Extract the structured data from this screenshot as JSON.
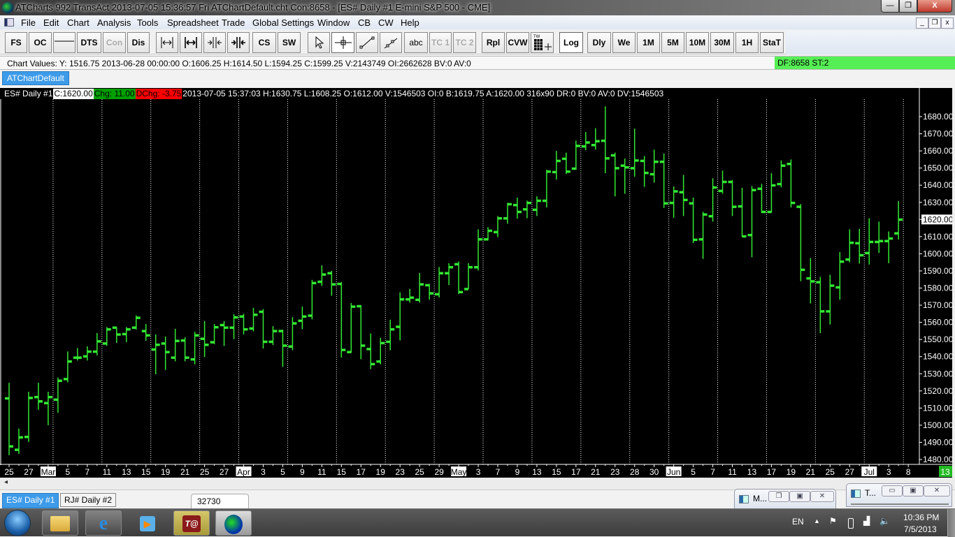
{
  "window": {
    "title": "ATCharts 992 TransAct 2013-07-05  15:36:57 Fri  ATChartDefault.cht Con:8658 - [ES#  Daily  #1  E-mini S&P 500 - CME]",
    "minimize": "—",
    "restore": "❐",
    "close": "X"
  },
  "menu": [
    "File",
    "Edit",
    "Chart",
    "Analysis",
    "Tools",
    "Spreadsheet",
    "Trade",
    "Global Settings",
    "Window",
    "CB",
    "CW",
    "Help"
  ],
  "mdi_controls": {
    "minimize": "_",
    "restore": "❐",
    "close": "x"
  },
  "toolbar": {
    "fs": "FS",
    "oc": "OC",
    "dts": "DTS",
    "con": "Con",
    "dis": "Dis",
    "cs": "CS",
    "sw": "SW",
    "abc": "abc",
    "tc1": "TC 1",
    "tc2": "TC 2",
    "rpl": "Rpl",
    "cvw": "CVW",
    "tw": "TW",
    "log": "Log",
    "dly": "Dly",
    "we": "We",
    "m1": "1M",
    "m5": "5M",
    "m10": "10M",
    "m30": "30M",
    "h1": "1H",
    "stat": "StaT"
  },
  "chart_values": {
    "text": "Chart Values: Y: 1516.75  2013-06-28  00:00:00  O:1606.25  H:1614.50  L:1594.25  C:1599.25  V:2143749  OI:2662628  BV:0  AV:0",
    "status": "DF:8658  ST:2"
  },
  "tabs": {
    "top": "ATChartDefault",
    "bottom": [
      "ES#  Daily  #1",
      "RJ#  Daily  #2"
    ]
  },
  "chart_header": {
    "symbol": "ES#  Daily  #1",
    "close": "C:1620.00",
    "chg": "Chg: 11.00",
    "dchg": "DChg: -3.75",
    "rest": "2013-07-05 15:37:03 H:1630.75 L:1608.25 O:1612.00 V:1546503 OI:0 B:1619.75 A:1620.00 316x90 DR:0 BV:0 AV:0 DV:1546503"
  },
  "colors": {
    "bar": "#33e833",
    "up_box": "#00a000",
    "down_box": "#ff0000",
    "status_green": "#55ee55",
    "tab_blue": "#3d9be9"
  },
  "chart_data": {
    "type": "ohlc",
    "symbol": "ES#",
    "ylim": [
      1480,
      1680
    ],
    "y_ticks": [
      "1680.00",
      "1670.00",
      "1660.00",
      "1650.00",
      "1640.00",
      "1630.00",
      "1620.00",
      "1610.00",
      "1600.00",
      "1590.00",
      "1580.00",
      "1570.00",
      "1560.00",
      "1550.00",
      "1540.00",
      "1530.00",
      "1520.00",
      "1510.00",
      "1500.00",
      "1490.00",
      "1480.00"
    ],
    "last_price_label": "1620.00",
    "last_price": 1620,
    "corner_label": "13",
    "week_start_bars": [
      5,
      10,
      15,
      20,
      24,
      29,
      34,
      39,
      44,
      49,
      54,
      59,
      64,
      68,
      73,
      78,
      83,
      88,
      92
    ],
    "x_labels": [
      {
        "bar": 0,
        "text": "25"
      },
      {
        "bar": 2,
        "text": "27"
      },
      {
        "bar": 4,
        "text": "Mar",
        "month": true
      },
      {
        "bar": 6,
        "text": "5"
      },
      {
        "bar": 8,
        "text": "7"
      },
      {
        "bar": 10,
        "text": "11"
      },
      {
        "bar": 12,
        "text": "13"
      },
      {
        "bar": 14,
        "text": "15"
      },
      {
        "bar": 16,
        "text": "19"
      },
      {
        "bar": 18,
        "text": "21"
      },
      {
        "bar": 20,
        "text": "25"
      },
      {
        "bar": 22,
        "text": "27"
      },
      {
        "bar": 24,
        "text": "Apr",
        "month": true
      },
      {
        "bar": 26,
        "text": "3"
      },
      {
        "bar": 28,
        "text": "5"
      },
      {
        "bar": 30,
        "text": "9"
      },
      {
        "bar": 32,
        "text": "11"
      },
      {
        "bar": 34,
        "text": "15"
      },
      {
        "bar": 36,
        "text": "17"
      },
      {
        "bar": 38,
        "text": "19"
      },
      {
        "bar": 40,
        "text": "23"
      },
      {
        "bar": 42,
        "text": "25"
      },
      {
        "bar": 44,
        "text": "29"
      },
      {
        "bar": 46,
        "text": "May",
        "month": true
      },
      {
        "bar": 48,
        "text": "3"
      },
      {
        "bar": 50,
        "text": "7"
      },
      {
        "bar": 52,
        "text": "9"
      },
      {
        "bar": 54,
        "text": "13"
      },
      {
        "bar": 56,
        "text": "15"
      },
      {
        "bar": 58,
        "text": "17"
      },
      {
        "bar": 60,
        "text": "21"
      },
      {
        "bar": 62,
        "text": "23"
      },
      {
        "bar": 64,
        "text": "28"
      },
      {
        "bar": 66,
        "text": "30"
      },
      {
        "bar": 68,
        "text": "Jun",
        "month": true
      },
      {
        "bar": 70,
        "text": "5"
      },
      {
        "bar": 72,
        "text": "7"
      },
      {
        "bar": 74,
        "text": "11"
      },
      {
        "bar": 76,
        "text": "13"
      },
      {
        "bar": 78,
        "text": "17"
      },
      {
        "bar": 80,
        "text": "19"
      },
      {
        "bar": 82,
        "text": "21"
      },
      {
        "bar": 84,
        "text": "25"
      },
      {
        "bar": 86,
        "text": "27"
      },
      {
        "bar": 88,
        "text": "Jul",
        "month": true
      },
      {
        "bar": 90,
        "text": "3"
      },
      {
        "bar": 92,
        "text": "8"
      }
    ],
    "ohlc": [
      [
        1515.75,
        1524.75,
        1482.5,
        1487.75
      ],
      [
        1485.75,
        1498,
        1483.25,
        1493
      ],
      [
        1493.25,
        1519.5,
        1490.25,
        1516
      ],
      [
        1516.5,
        1524.75,
        1509,
        1514
      ],
      [
        1513,
        1519.5,
        1500,
        1516.5
      ],
      [
        1515,
        1527.75,
        1507.25,
        1526
      ],
      [
        1527,
        1543,
        1525,
        1537.25
      ],
      [
        1539.5,
        1545,
        1537.75,
        1539.5
      ],
      [
        1540.25,
        1546,
        1537.75,
        1543
      ],
      [
        1543,
        1553.75,
        1540.75,
        1549
      ],
      [
        1547.75,
        1557.25,
        1546.25,
        1556
      ],
      [
        1557,
        1557.25,
        1548,
        1553
      ],
      [
        1553.25,
        1557.25,
        1548.5,
        1556
      ],
      [
        1557,
        1564,
        1555.75,
        1562.75
      ],
      [
        1555,
        1559,
        1549.25,
        1552.5
      ],
      [
        1544.25,
        1553,
        1529.75,
        1547
      ],
      [
        1547.75,
        1551.75,
        1532.25,
        1542.75
      ],
      [
        1539.5,
        1556.25,
        1537.25,
        1549.25
      ],
      [
        1549.5,
        1551.25,
        1537.25,
        1539.5
      ],
      [
        1538.5,
        1554.5,
        1535.5,
        1552.5
      ],
      [
        1550.5,
        1560.75,
        1539.75,
        1547
      ],
      [
        1548.5,
        1559,
        1547.25,
        1557.25
      ],
      [
        1558.5,
        1560.75,
        1546.25,
        1557
      ],
      [
        1557,
        1564.75,
        1550.25,
        1563
      ],
      [
        1563.5,
        1565,
        1553,
        1556
      ],
      [
        1556.5,
        1568.5,
        1554.75,
        1564.5
      ],
      [
        1566.25,
        1567.75,
        1544.75,
        1548.75
      ],
      [
        1548.75,
        1557.75,
        1546.75,
        1555
      ],
      [
        1555,
        1555.75,
        1534,
        1546.5
      ],
      [
        1546,
        1563,
        1543.75,
        1559.5
      ],
      [
        1561,
        1569.25,
        1556,
        1563.5
      ],
      [
        1564,
        1584.75,
        1561.75,
        1583
      ],
      [
        1583.75,
        1593.25,
        1581.25,
        1588
      ],
      [
        1588.75,
        1590,
        1575.5,
        1582.25
      ],
      [
        1582.5,
        1583.5,
        1539.5,
        1544
      ],
      [
        1542.75,
        1571.25,
        1542.25,
        1569.25
      ],
      [
        1569.5,
        1570,
        1538.5,
        1546.5
      ],
      [
        1544.5,
        1553.5,
        1532.75,
        1535.75
      ],
      [
        1537.25,
        1551,
        1535.5,
        1548
      ],
      [
        1548.75,
        1561.5,
        1543.75,
        1556
      ],
      [
        1557.5,
        1577.5,
        1549.5,
        1573.5
      ],
      [
        1573.5,
        1579.5,
        1571.5,
        1574.5
      ],
      [
        1573.25,
        1588.75,
        1571.5,
        1582.25
      ],
      [
        1581.75,
        1582.5,
        1573.25,
        1577
      ],
      [
        1576.5,
        1592.25,
        1574.5,
        1588.75
      ],
      [
        1588.75,
        1594.5,
        1581.75,
        1592.25
      ],
      [
        1594,
        1595.5,
        1576.5,
        1577.75
      ],
      [
        1579.5,
        1594.5,
        1579.5,
        1592.25
      ],
      [
        1592.25,
        1614.25,
        1590.25,
        1608.5
      ],
      [
        1608.5,
        1615.5,
        1607.75,
        1613.5
      ],
      [
        1612.75,
        1622,
        1609.75,
        1620.75
      ],
      [
        1620.75,
        1629.75,
        1617.5,
        1629
      ],
      [
        1628.5,
        1632.75,
        1620.5,
        1624.5
      ],
      [
        1626,
        1631,
        1620.75,
        1629.75
      ],
      [
        1625.75,
        1633.5,
        1622,
        1631
      ],
      [
        1631,
        1649,
        1627,
        1648
      ],
      [
        1647.75,
        1660,
        1643.25,
        1654.25
      ],
      [
        1655.5,
        1659,
        1646.5,
        1648
      ],
      [
        1649.75,
        1666,
        1649,
        1663
      ],
      [
        1662.75,
        1671,
        1660.5,
        1665
      ],
      [
        1663.5,
        1673.25,
        1660.75,
        1665.75
      ],
      [
        1666,
        1686,
        1647,
        1655.75
      ],
      [
        1657.5,
        1659,
        1633.5,
        1650
      ],
      [
        1651.5,
        1655.5,
        1635,
        1650.5
      ],
      [
        1650,
        1673,
        1645,
        1654.5
      ],
      [
        1654.25,
        1657,
        1639,
        1647.25
      ],
      [
        1646.5,
        1660.75,
        1641.5,
        1653.75
      ],
      [
        1653.75,
        1658.5,
        1626.75,
        1629.5
      ],
      [
        1629.75,
        1639.25,
        1621,
        1636.5
      ],
      [
        1636,
        1646,
        1622,
        1631.5
      ],
      [
        1629.5,
        1632.75,
        1606.25,
        1608.25
      ],
      [
        1608.5,
        1624.5,
        1597,
        1623
      ],
      [
        1622,
        1644,
        1618.75,
        1638.75
      ],
      [
        1636.75,
        1648.5,
        1635,
        1642
      ],
      [
        1642,
        1643,
        1622,
        1627.5
      ],
      [
        1627.75,
        1638.5,
        1610,
        1610.25
      ],
      [
        1611,
        1639.5,
        1598,
        1637.25
      ],
      [
        1638,
        1640.75,
        1623.75,
        1624.5
      ],
      [
        1624.5,
        1647,
        1624,
        1640
      ],
      [
        1640.75,
        1654.5,
        1638.75,
        1651.5
      ],
      [
        1652.5,
        1655,
        1627,
        1629.75
      ],
      [
        1627.5,
        1629,
        1584,
        1590.75
      ],
      [
        1585.75,
        1597.5,
        1571,
        1584
      ],
      [
        1583.5,
        1586.5,
        1553.75,
        1566.5
      ],
      [
        1566.5,
        1587.75,
        1558.75,
        1581.5
      ],
      [
        1580.5,
        1601,
        1573.25,
        1595.5
      ],
      [
        1596.75,
        1614.25,
        1595,
        1606.5
      ],
      [
        1606.25,
        1614.5,
        1594.25,
        1599.25
      ],
      [
        1600.5,
        1620.75,
        1593.75,
        1607
      ],
      [
        1607,
        1618.75,
        1600.5,
        1607.5
      ],
      [
        1607.5,
        1613,
        1594.5,
        1609
      ],
      [
        1612,
        1630.75,
        1608.25,
        1620
      ]
    ]
  },
  "tooltip": "32730",
  "minimized_windows": [
    {
      "label": "M..."
    },
    {
      "label": "T..."
    }
  ],
  "taskbar": {
    "lang": "EN",
    "time": "10:36 PM",
    "date": "7/5/2013"
  }
}
